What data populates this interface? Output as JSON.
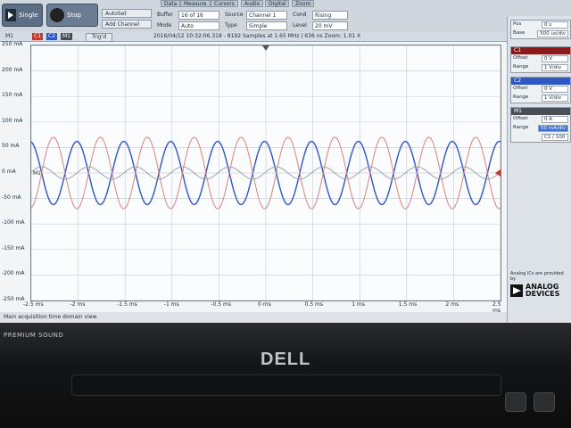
{
  "toolbar": {
    "single_label": "Single",
    "stop_label": "Stop",
    "autoset_label": "AutoSet",
    "add_channel_label": "Add Channel",
    "menus": [
      "Data",
      "Measure",
      "Cursors",
      "Audio",
      "Digital",
      "Zoom"
    ],
    "buffer_label": "Buffer",
    "buffer_value": "16 of 16",
    "mode_label": "Mode",
    "mode_value": "Auto",
    "source_label": "Source",
    "source_value": "Channel 1",
    "type_label": "Type",
    "type_value": "Simple",
    "condition_label": "Cond",
    "condition_value": "Rising",
    "level_label": "Level",
    "level_value": "20 mV"
  },
  "plot_window": {
    "tab_label": "M1",
    "channel_tags": [
      "C1",
      "C2",
      "M1"
    ],
    "trig_status": "Trig'd",
    "acquisition_info": "2016/04/12 10:32:06.318 - 8192 Samples at 1.65 MHz | 636 ns Zoom: 1.01 X",
    "marker_label": "M1"
  },
  "chart_data": {
    "type": "line",
    "yticks": [
      "250 mA",
      "200 mA",
      "150 mA",
      "100 mA",
      "50 mA",
      "0 mA",
      "-50 mA",
      "-100 mA",
      "-150 mA",
      "-200 mA",
      "-250 mA"
    ],
    "xticks": [
      "-2.5 ms",
      "-2 ms",
      "-1.5 ms",
      "-1 ms",
      "-0.5 ms",
      "0 ms",
      "0.5 ms",
      "1 ms",
      "1.5 ms",
      "2 ms",
      "2.5 ms"
    ],
    "xlim": [
      -2.5,
      2.5
    ],
    "ylim": [
      -250,
      250
    ],
    "grid": true,
    "series": [
      {
        "color": "#2f56c9",
        "amplitude": 62,
        "period_ms": 0.5,
        "phase_deg": 100
      },
      {
        "color": "#d9827a",
        "amplitude": 70,
        "period_ms": 0.5,
        "phase_deg": -80
      },
      {
        "color": "#9fa3a8",
        "amplitude": 12,
        "period_ms": 0.5,
        "phase_deg": 10
      }
    ]
  },
  "status_bar": {
    "text": "Main acquisition time domain view."
  },
  "side_panel": {
    "time_card": {
      "pos_label": "Pos",
      "pos_value": "0 s",
      "base_label": "Base",
      "base_value": "500 us/div"
    },
    "c1_card": {
      "title": "C1",
      "offset_label": "Offset",
      "offset_value": "0 V",
      "range_label": "Range",
      "range_value": "1 V/div"
    },
    "c2_card": {
      "title": "C2",
      "offset_label": "Offset",
      "offset_value": "0 V",
      "range_label": "Range",
      "range_value": "1 V/div"
    },
    "m1_card": {
      "title": "M1",
      "offset_label": "Offset",
      "offset_value": "0 A",
      "range_label": "Range",
      "range_value": "50 mA/div",
      "formula": "C1 / 100"
    }
  },
  "branding": {
    "adi_caption": "Analog ICs are provided by",
    "adi_name_line1": "ANALOG",
    "adi_name_line2": "DEVICES",
    "bezel_text": "PREMIUM SOUND",
    "logo_text": "DELL"
  }
}
